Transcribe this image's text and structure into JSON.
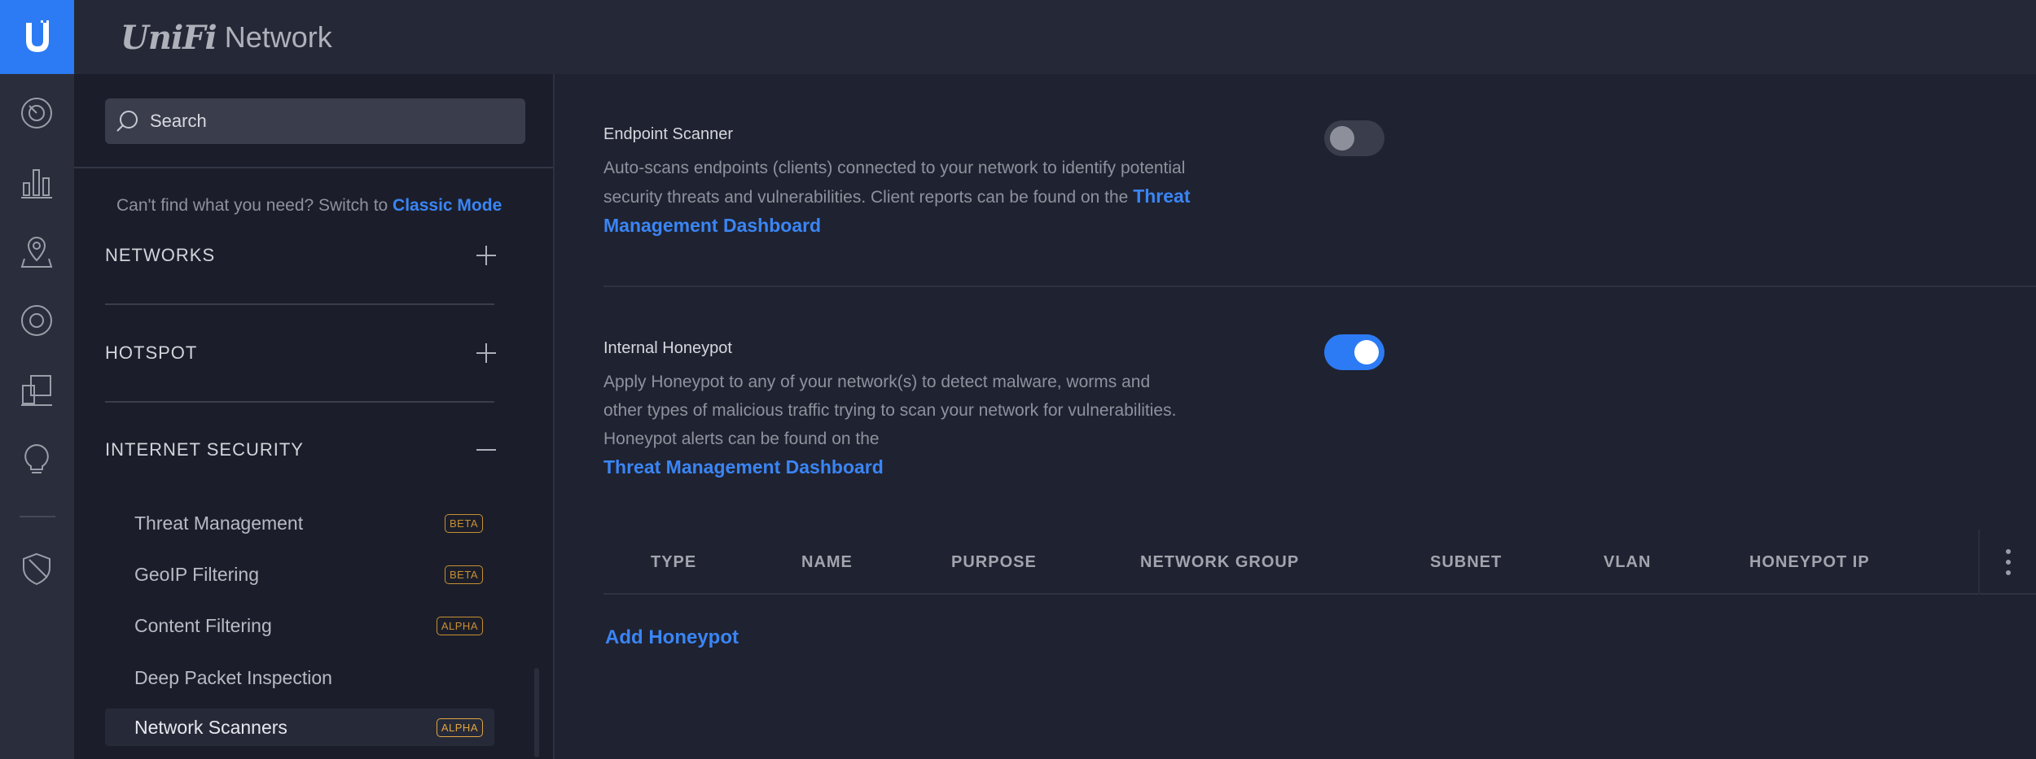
{
  "brand": {
    "unifi": "UniFi",
    "network": "Network"
  },
  "search": {
    "placeholder": "Search"
  },
  "classic_mode": {
    "prefix": "Can't find what you need? Switch to ",
    "link": "Classic Mode"
  },
  "sections": {
    "networks": "NETWORKS",
    "hotspot": "HOTSPOT",
    "internet_security": "INTERNET SECURITY"
  },
  "security_items": [
    {
      "label": "Threat Management",
      "badge": "BETA"
    },
    {
      "label": "GeoIP Filtering",
      "badge": "BETA"
    },
    {
      "label": "Content Filtering",
      "badge": "ALPHA"
    },
    {
      "label": "Deep Packet Inspection",
      "badge": ""
    },
    {
      "label": "Network Scanners",
      "badge": "ALPHA",
      "active": true
    }
  ],
  "endpoint_scanner": {
    "title": "Endpoint Scanner",
    "description": "Auto-scans endpoints (clients) connected to your network to identify potential security threats and vulnerabilities. Client reports can be found on the ",
    "link": "Threat Management Dashboard",
    "enabled": false
  },
  "internal_honeypot": {
    "title": "Internal Honeypot",
    "description": "Apply Honeypot to any of your network(s) to detect malware, worms and other types of malicious traffic trying to scan your network for vulnerabilities. Honeypot alerts can be found on the",
    "link": "Threat Management Dashboard",
    "enabled": true
  },
  "honeypot_table": {
    "columns": [
      "TYPE",
      "NAME",
      "PURPOSE",
      "NETWORK GROUP",
      "SUBNET",
      "VLAN",
      "HONEYPOT IP"
    ]
  },
  "add_honeypot": "Add Honeypot",
  "colors": {
    "accent": "#2c7bf4",
    "link": "#3a85f5",
    "badge": "#c88f33",
    "background": "#1f2230",
    "sidebar": "#1b1e2a"
  },
  "icons": {
    "logo": "ubiquiti-u-icon",
    "rail": [
      "dashboard-icon",
      "statistics-icon",
      "map-icon",
      "devices-icon",
      "clients-icon",
      "insights-icon",
      "threat-shield-icon"
    ]
  }
}
